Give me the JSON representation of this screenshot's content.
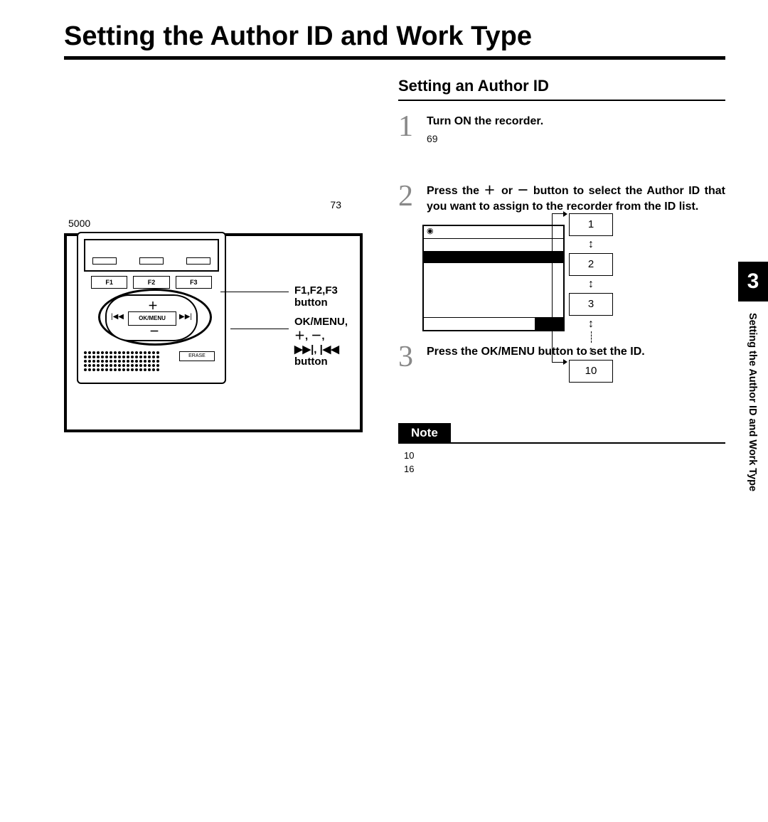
{
  "title": "Setting the Author ID and Work Type",
  "left": {
    "num_73": "73",
    "num_5000": "5000",
    "fkeys": [
      "F1",
      "F2",
      "F3"
    ],
    "okmenu": "OK/MENU",
    "erase": "ERASE",
    "callout_fkeys": "F1,F2,F3\nbutton",
    "callout_nav": "OK/MENU,＋, －,\n▶▶|, |◀◀\nbutton"
  },
  "right": {
    "section_title": "Setting an Author ID",
    "steps": [
      {
        "num": "1",
        "text": "Turn ON the recorder.",
        "sub": "69"
      },
      {
        "num": "2",
        "text": "Press the ＋ or － button to select the Author ID that you want to assign to the recorder from the ID list."
      },
      {
        "num": "3",
        "text": "Press the OK/MENU button to set the ID."
      }
    ],
    "idboxes": [
      "1",
      "2",
      "3",
      "10"
    ],
    "note_label": "Note",
    "note_nums": [
      "10",
      "16"
    ]
  },
  "sidetab": {
    "chapter": "3",
    "label": "Setting the Author ID and Work Type"
  }
}
